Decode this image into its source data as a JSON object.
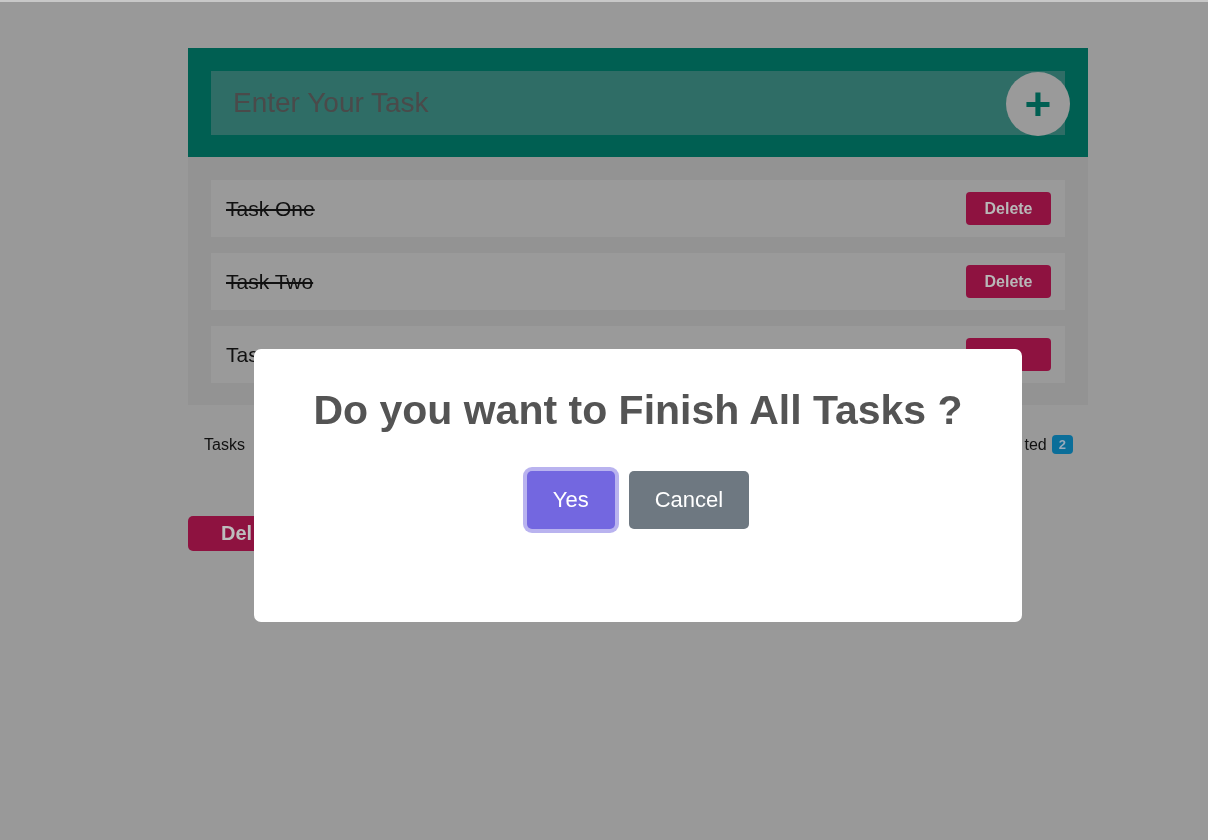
{
  "task_input": {
    "placeholder": "Enter Your Task",
    "add_button": "+"
  },
  "tasks": [
    {
      "name": "Task One",
      "done": true,
      "delete_label": "Delete"
    },
    {
      "name": "Task Two",
      "done": true,
      "delete_label": "Delete"
    },
    {
      "name": "Tas",
      "done": false
    }
  ],
  "stats": {
    "left_label": "Tasks",
    "right_label": "ted",
    "right_count": "2"
  },
  "delete_all_label": "Del",
  "dialog": {
    "title": "Do you want to Finish All Tasks ?",
    "buttons": [
      {
        "label": "Yes",
        "kind": "confirm",
        "focused": true
      },
      {
        "label": "Cancel",
        "kind": "cancel",
        "focused": false
      }
    ]
  }
}
